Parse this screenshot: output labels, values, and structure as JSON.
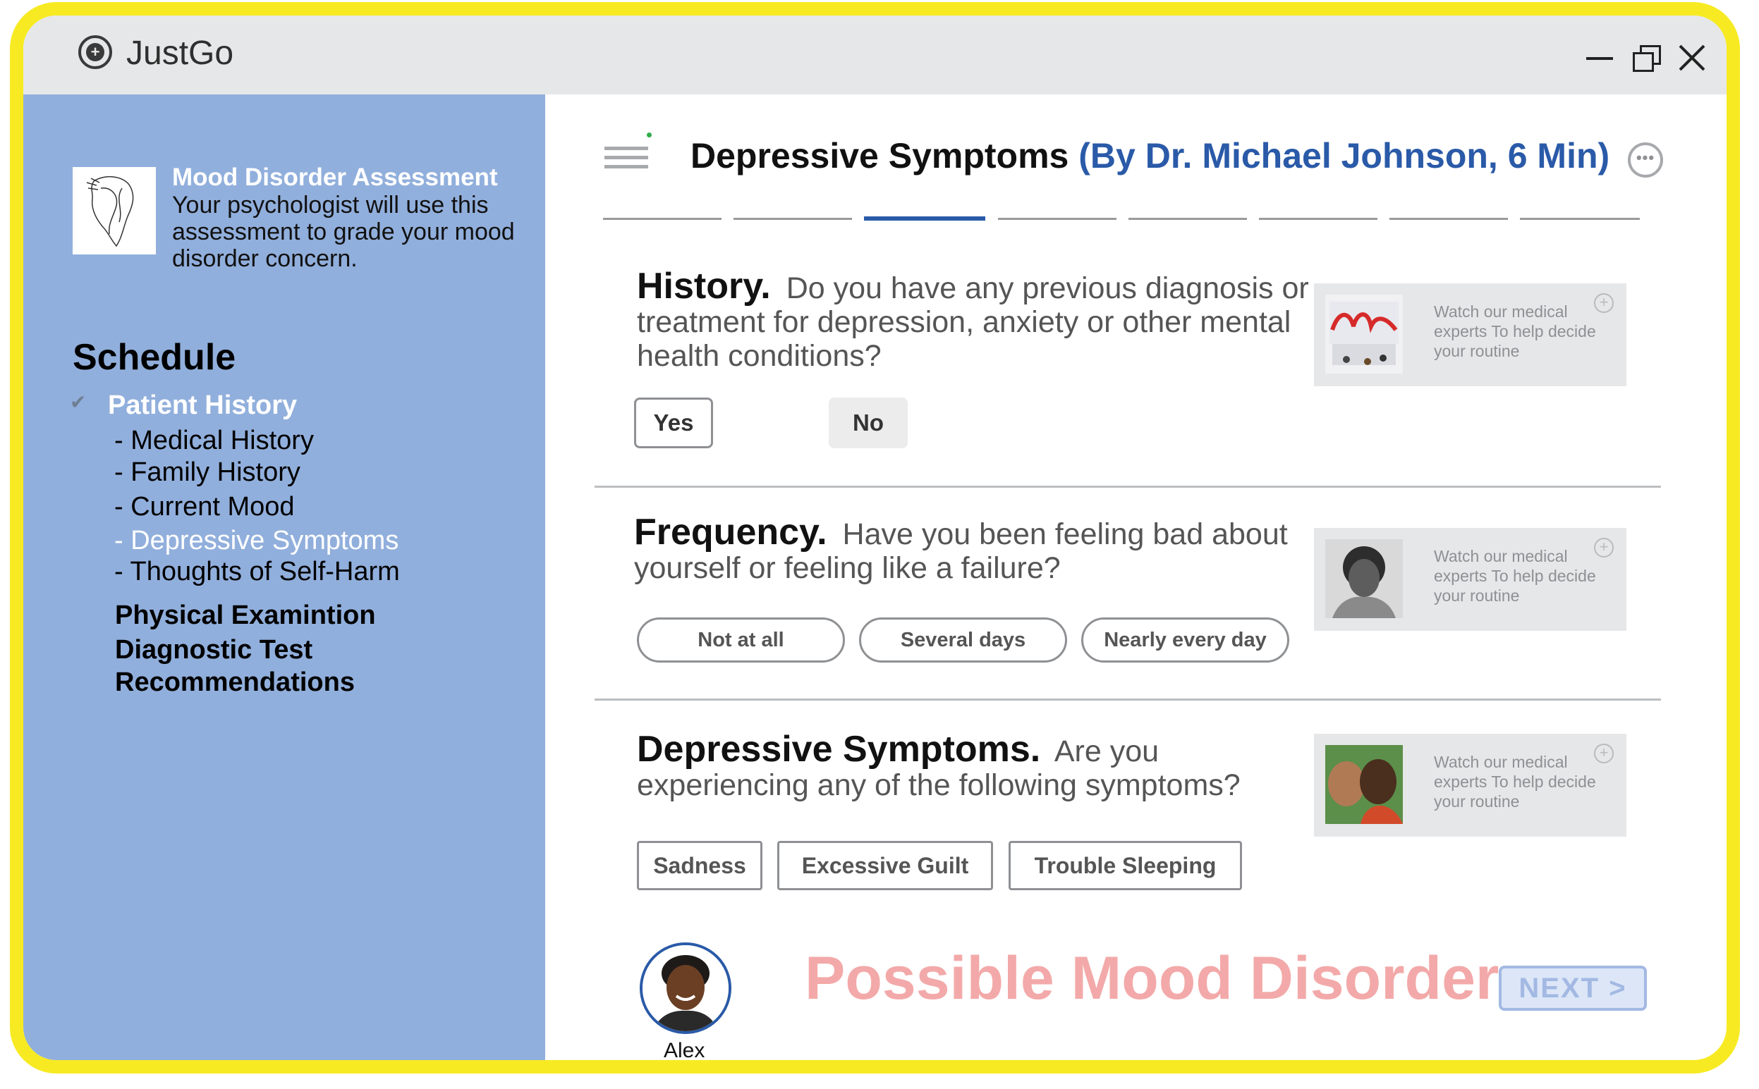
{
  "app": {
    "title": "JustGo",
    "logo_icon": "record-button-icon",
    "window_controls": [
      "minimize-icon",
      "restore-icon",
      "close-icon"
    ]
  },
  "sidebar": {
    "assessment": {
      "title": "Mood Disorder Assessment",
      "description": "Your psychologist will use this assessment to grade your mood disorder concern."
    },
    "schedule_title": "Schedule",
    "sections": {
      "patient_history": "Patient History",
      "physical": "Physical Examintion",
      "diagnostic": "Diagnostic Test",
      "recommendations": "Recommendations"
    },
    "subitems": {
      "medical": "- Medical History",
      "family": "- Family History",
      "mood": "- Current Mood",
      "depressive": "- Depressive Symptoms",
      "self_harm": "- Thoughts of Self-Harm"
    }
  },
  "header": {
    "title": "Depressive Symptoms",
    "subtitle": "(By Dr. Michael Johnson, 6 Min)",
    "progress": {
      "total_steps": 8,
      "current_step": 3
    }
  },
  "questions": {
    "history": {
      "label": "History.",
      "text": "Do you have any previous diagnosis or treatment for depression, anxiety or other mental health conditions?",
      "options": {
        "yes": "Yes",
        "no": "No"
      }
    },
    "frequency": {
      "label": "Frequency.",
      "text": "Have you been feeling bad about yourself or feeling like a failure?",
      "options": {
        "a": "Not at all",
        "b": "Several days",
        "c": "Nearly every day"
      }
    },
    "symptoms": {
      "label": "Depressive Symptoms.",
      "text": "Are you experiencing any of the following symptoms?",
      "options": {
        "a": "Sadness",
        "b": "Excessive Guilt",
        "c": "Trouble Sleeping"
      }
    }
  },
  "video_card_text": "Watch our medical experts To help decide your routine",
  "footer": {
    "patient_name": "Alex",
    "result": "Possible Mood Disorder",
    "next_label": "NEXT  >"
  },
  "colors": {
    "accent": "#2a5aa8",
    "sidebar": "#91afdc",
    "frame": "#f7ea22",
    "result": "#f3a9a9"
  }
}
